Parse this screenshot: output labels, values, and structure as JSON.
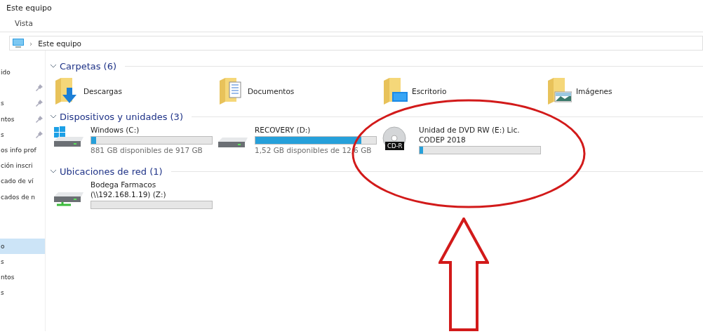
{
  "window": {
    "title": "Este equipo"
  },
  "ribbon": {
    "tab": "Vista"
  },
  "address_bar": {
    "separator": "›",
    "path": "Este equipo"
  },
  "sidebar": {
    "groups": [
      {
        "items": [
          {
            "label": "ido",
            "pinned": false,
            "selected": false
          },
          {
            "pinned": true,
            "selected": false
          },
          {
            "label": "s",
            "pinned": true,
            "selected": false
          },
          {
            "label": "ntos",
            "pinned": true,
            "selected": false
          },
          {
            "label": "s",
            "pinned": true,
            "selected": false
          },
          {
            "label": "os info prof",
            "pinned": false,
            "selected": false
          },
          {
            "label": "ción inscri",
            "pinned": false,
            "selected": false
          },
          {
            "label": "cado de ví",
            "pinned": false,
            "selected": false
          },
          {
            "label": "cados de n",
            "pinned": false,
            "selected": false
          }
        ]
      },
      {
        "items": [
          {
            "label": "o",
            "pinned": false,
            "selected": true
          },
          {
            "label": "s",
            "pinned": false,
            "selected": false
          },
          {
            "label": "ntos",
            "pinned": false,
            "selected": false
          },
          {
            "label": "s",
            "pinned": false,
            "selected": false
          }
        ]
      }
    ]
  },
  "sections": [
    {
      "title": "Carpetas (6)",
      "expanded": true,
      "items": [
        {
          "kind": "folder",
          "name": "Descargas"
        },
        {
          "kind": "folder",
          "name": "Documentos"
        },
        {
          "kind": "folder",
          "name": "Escritorio"
        },
        {
          "kind": "folder",
          "name": "Imágenes"
        }
      ]
    },
    {
      "title": "Dispositivos y unidades (3)",
      "expanded": true,
      "items": [
        {
          "kind": "drive",
          "name": "Windows (C:)",
          "level": 0.04,
          "space": "881 GB disponibles de 917 GB"
        },
        {
          "kind": "drive",
          "name": "RECOVERY (D:)",
          "level": 0.88,
          "space": "1,52 GB disponibles de 12,6 GB"
        },
        {
          "kind": "disc",
          "name": "Unidad de DVD RW (E:) Lic. CODEP 2018",
          "badge": "CD-R",
          "level": 0.03
        }
      ]
    },
    {
      "title": "Ubicaciones de red (1)",
      "expanded": true,
      "items": [
        {
          "kind": "network",
          "name": "Bodega Farmacos (\\\\192.168.1.19) (Z:)",
          "level": 0
        }
      ]
    }
  ]
}
